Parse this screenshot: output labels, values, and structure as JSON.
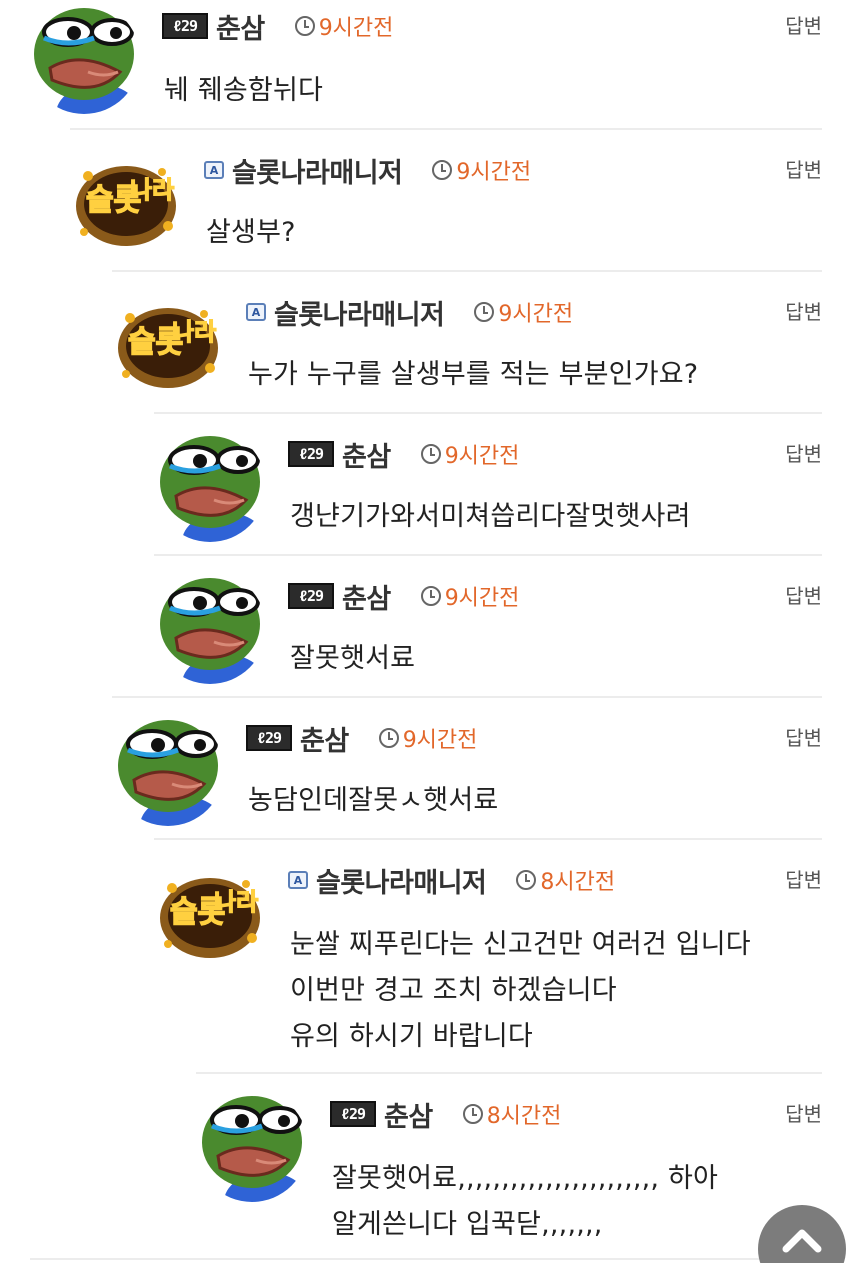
{
  "reply_label": "답변",
  "comments": [
    {
      "level": "ℓ29",
      "nickname": "춘삼",
      "time": "9시간전",
      "avatar": "pepe",
      "admin": false,
      "lines": [
        "눼 줴송함뉘다"
      ]
    },
    {
      "level": "",
      "nickname": "슬롯나라매니저",
      "time": "9시간전",
      "avatar": "slotnara",
      "admin": true,
      "lines": [
        "살생부?"
      ]
    },
    {
      "level": "",
      "nickname": "슬롯나라매니저",
      "time": "9시간전",
      "avatar": "slotnara",
      "admin": true,
      "lines": [
        "누가 누구를 살생부를 적는 부분인가요?"
      ]
    },
    {
      "level": "ℓ29",
      "nickname": "춘삼",
      "time": "9시간전",
      "avatar": "pepe",
      "admin": false,
      "lines": [
        "갱냔기가와서미쳐씁리다잘멋햇사려"
      ]
    },
    {
      "level": "ℓ29",
      "nickname": "춘삼",
      "time": "9시간전",
      "avatar": "pepe",
      "admin": false,
      "lines": [
        "잘못햇서료"
      ]
    },
    {
      "level": "ℓ29",
      "nickname": "춘삼",
      "time": "9시간전",
      "avatar": "pepe",
      "admin": false,
      "lines": [
        "농담인데잘못ㅅ햇서료"
      ]
    },
    {
      "level": "",
      "nickname": "슬롯나라매니저",
      "time": "8시간전",
      "avatar": "slotnara",
      "admin": true,
      "lines": [
        "눈쌀 찌푸린다는 신고건만 여러건 입니다",
        "이번만 경고 조치 하겠습니다",
        "유의 하시기 바랍니다"
      ]
    },
    {
      "level": "ℓ29",
      "nickname": "춘삼",
      "time": "8시간전",
      "avatar": "pepe",
      "admin": false,
      "lines": [
        "잘못햇어료,,,,,,,,,,,,,,,,,,,,,,, 하아",
        "알게쓴니다 입꾹닫,,,,,,,"
      ]
    }
  ]
}
